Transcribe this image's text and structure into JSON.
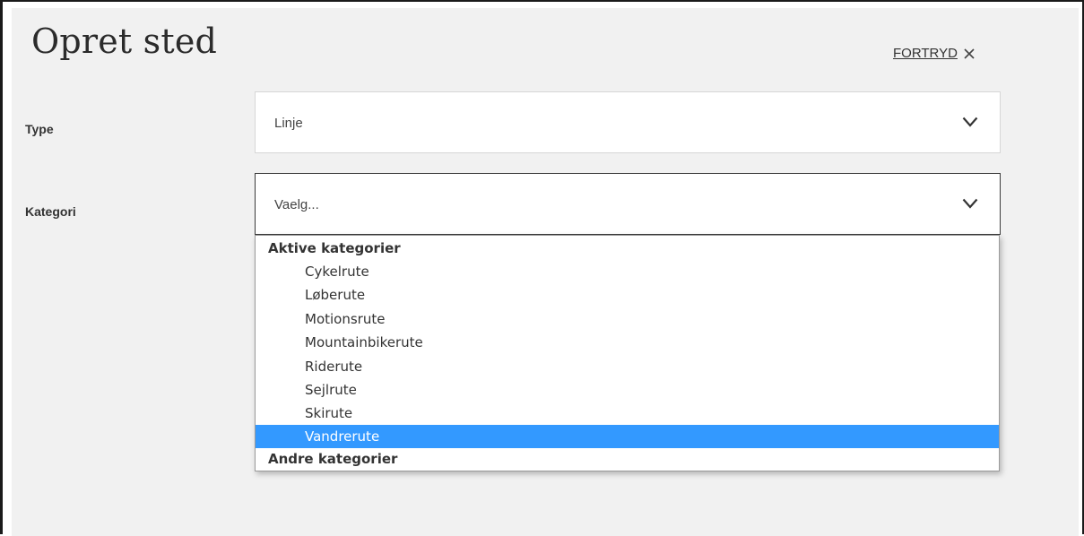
{
  "form": {
    "title": "Opret sted",
    "cancel_label": "FORTRYD",
    "cancel_icon": "close-icon"
  },
  "type_field": {
    "label": "Type",
    "value": "Linje",
    "icon": "chevron-down-icon"
  },
  "category_field": {
    "label": "Kategori",
    "value": "Vaelg...",
    "icon": "chevron-down-icon"
  },
  "dropdown": {
    "groups": [
      {
        "label": "Aktive kategorier",
        "options": [
          "Cykelrute",
          "Løberute",
          "Motionsrute",
          "Mountainbikerute",
          "Riderute",
          "Sejlrute",
          "Skirute",
          "Vandrerute"
        ]
      },
      {
        "label": "Andre kategorier",
        "options": []
      }
    ],
    "selected": "Vandrerute"
  },
  "colors": {
    "highlight": "#3399ff",
    "panel_bg": "#f1f1f1"
  }
}
